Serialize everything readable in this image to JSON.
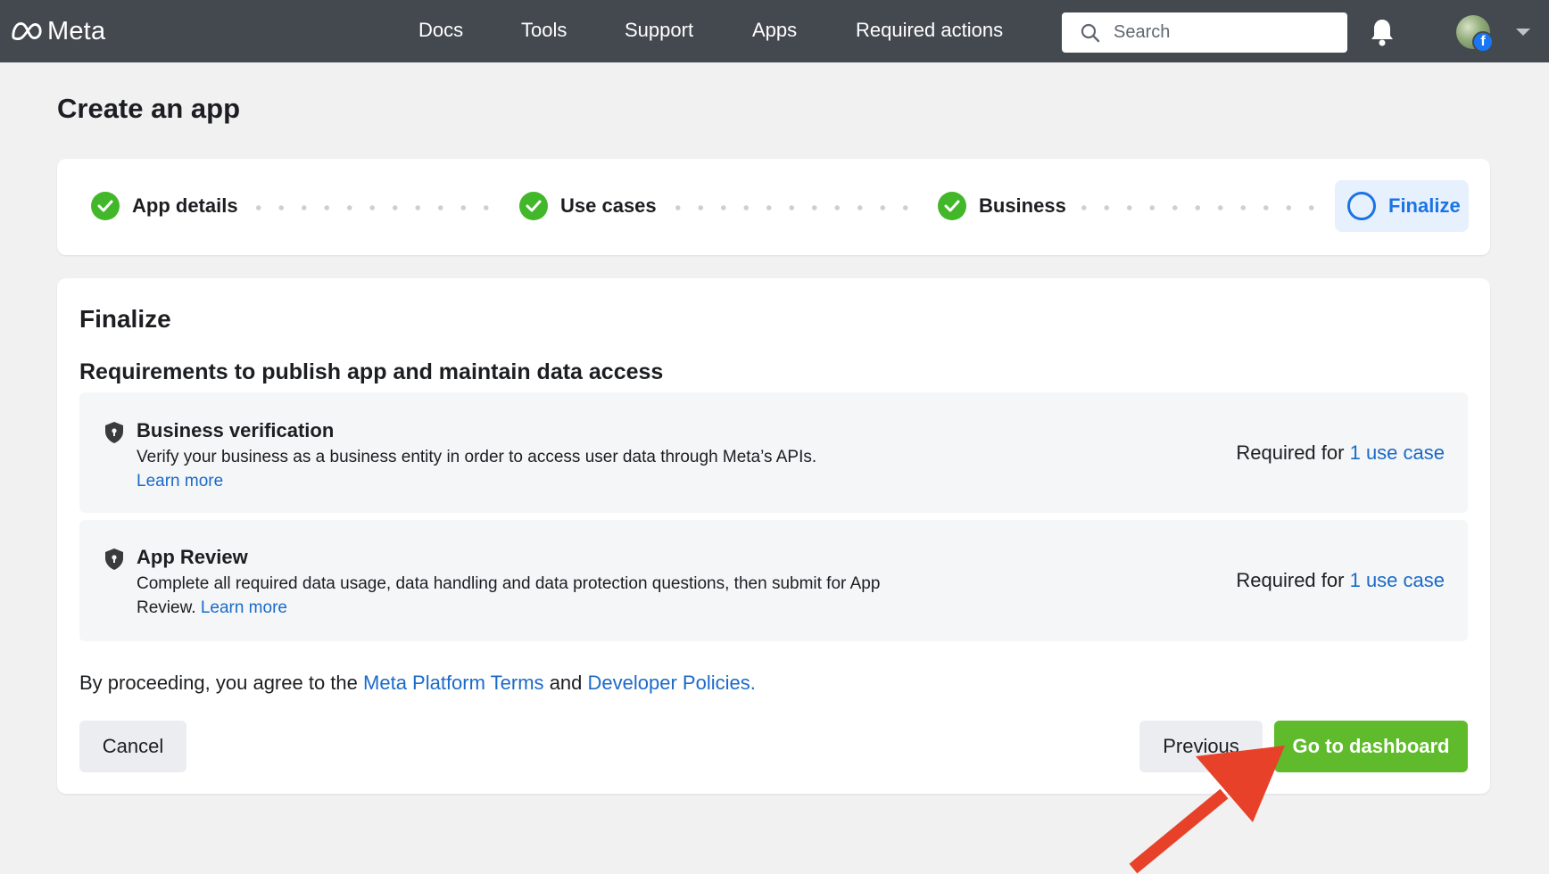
{
  "header": {
    "logo_text": "Meta",
    "nav": [
      "Docs",
      "Tools",
      "Support",
      "Apps",
      "Required actions"
    ],
    "search_placeholder": "Search"
  },
  "page": {
    "title": "Create an app"
  },
  "stepper": {
    "steps": [
      {
        "label": "App details",
        "status": "complete"
      },
      {
        "label": "Use cases",
        "status": "complete"
      },
      {
        "label": "Business",
        "status": "complete"
      },
      {
        "label": "Finalize",
        "status": "active"
      }
    ]
  },
  "finalize": {
    "title": "Finalize",
    "section_title": "Requirements to publish app and maintain data access",
    "requirements": [
      {
        "title": "Business verification",
        "description": "Verify your business as a business entity in order to access user data through Meta’s APIs.",
        "link": "Learn more",
        "required_for": "Required for",
        "required_link": "1 use case"
      },
      {
        "title": "App Review",
        "description": "Complete all required data usage, data handling and data protection questions, then submit for App Review.",
        "link": "Learn more",
        "required_for": "Required for",
        "required_link": "1 use case"
      }
    ],
    "agree": {
      "prefix": "By proceeding, you agree to the",
      "terms_link": "Meta Platform Terms",
      "and": "and",
      "policies_link": "Developer Policies."
    }
  },
  "buttons": {
    "cancel": "Cancel",
    "previous": "Previous",
    "go_to_dashboard": "Go to dashboard"
  },
  "colors": {
    "topbar": "#444950",
    "accent_blue": "#1b74e4",
    "success_green": "#42b72a",
    "primary_button": "#5fbb2b",
    "annotation_arrow": "#e8412a"
  },
  "icons": [
    "meta-logo-icon",
    "search-icon",
    "bell-icon",
    "avatar",
    "facebook-badge-icon",
    "chevron-down-icon",
    "check-icon",
    "shield-icon",
    "arrow-annotation"
  ]
}
